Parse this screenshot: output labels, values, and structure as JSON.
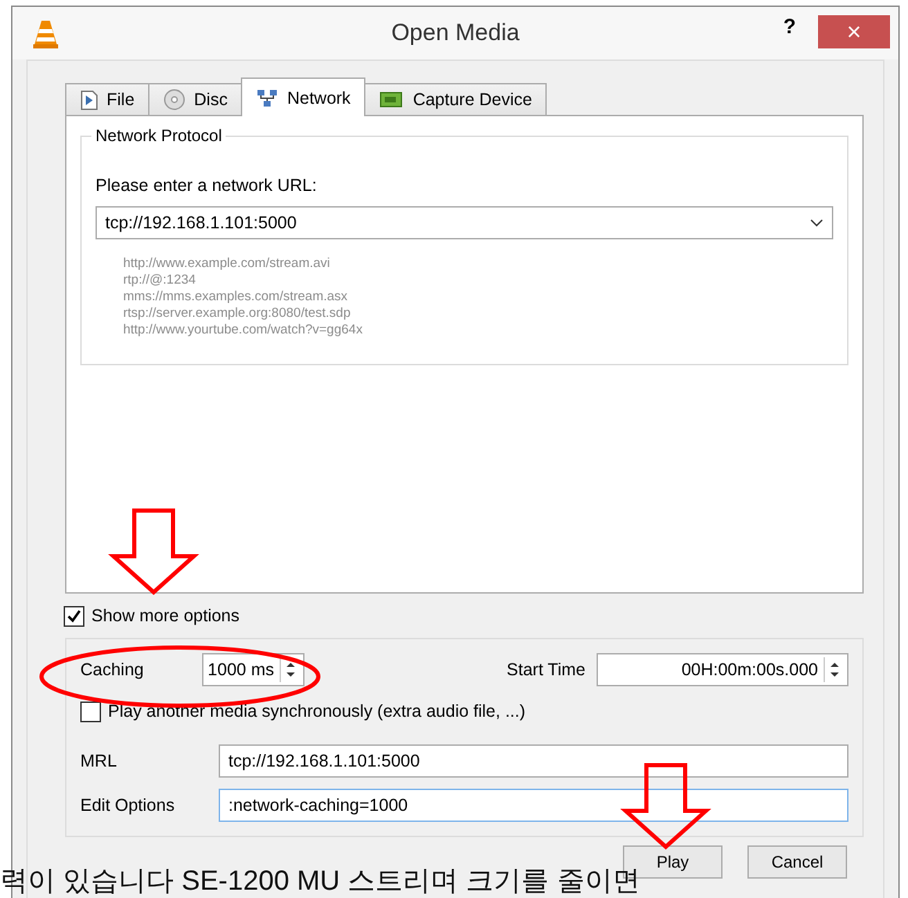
{
  "window": {
    "title": "Open Media",
    "help": "?",
    "close": "×"
  },
  "tabs": [
    {
      "label": "File",
      "selected": false
    },
    {
      "label": "Disc",
      "selected": false
    },
    {
      "label": "Network",
      "selected": true
    },
    {
      "label": "Capture Device",
      "selected": false
    }
  ],
  "network_protocol": {
    "title": "Network Protocol",
    "prompt": "Please enter a network URL:",
    "url": "tcp://192.168.1.101:5000",
    "examples": [
      "http://www.example.com/stream.avi",
      "rtp://@:1234",
      "mms://mms.examples.com/stream.asx",
      "rtsp://server.example.org:8080/test.sdp",
      "http://www.yourtube.com/watch?v=gg64x"
    ]
  },
  "show_more_options": {
    "label": "Show more options",
    "checked": true
  },
  "options": {
    "caching": {
      "label": "Caching",
      "value": "1000 ms"
    },
    "start_time": {
      "label": "Start Time",
      "value": "00H:00m:00s.000"
    },
    "play_another": {
      "label": "Play another media synchronously (extra audio file, ...)",
      "checked": false
    },
    "mrl": {
      "label": "MRL",
      "value": "tcp://192.168.1.101:5000"
    },
    "edit_options": {
      "label": "Edit Options",
      "value": ":network-caching=1000"
    }
  },
  "buttons": [
    "Play",
    "Cancel"
  ],
  "caption": "력이 있습니다 SE-1200 MU 스트리며 크기를 줄이면"
}
